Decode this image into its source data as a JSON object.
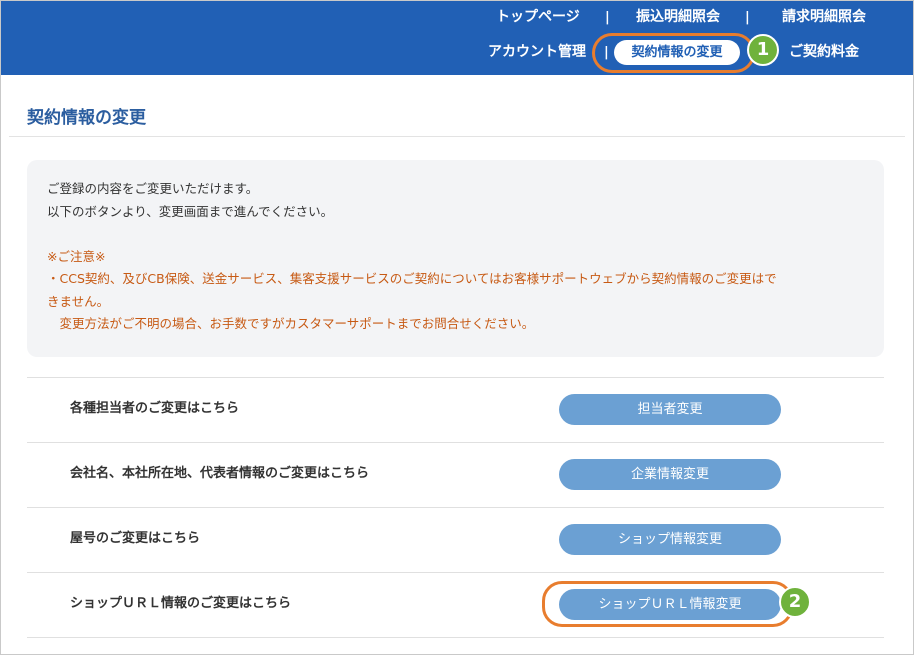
{
  "header": {
    "nav_top": [
      "トップページ",
      "振込明細照会",
      "請求明細照会"
    ],
    "nav_bottom": {
      "account": "アカウント管理",
      "active": "契約情報の変更",
      "fee": "ご契約料金"
    },
    "separator": "|",
    "bg_color": "#2160b5"
  },
  "page": {
    "title": "契約情報の変更"
  },
  "notice": {
    "line1": "ご登録の内容をご変更いただけます。",
    "line2": "以下のボタンより、変更画面まで進んでください。",
    "caution_title": "※ご注意※",
    "caution1": "・CCS契約、及びCB保険、送金サービス、集客支援サービスのご契約についてはお客様サポートウェブから契約情報のご変更はで",
    "caution2": "きません。",
    "caution3": "　変更方法がご不明の場合、お手数ですがカスタマーサポートまでお問合せください。"
  },
  "rows": [
    {
      "label": "各種担当者のご変更はこちら",
      "button": "担当者変更"
    },
    {
      "label": "会社名、本社所在地、代表者情報のご変更はこちら",
      "button": "企業情報変更"
    },
    {
      "label": "屋号のご変更はこちら",
      "button": "ショップ情報変更"
    },
    {
      "label": "ショップＵＲＬ情報のご変更はこちら",
      "button": "ショップＵＲＬ情報変更"
    }
  ],
  "annotations": {
    "step1": "1",
    "step2": "2",
    "highlight_color": "#e87d2e",
    "badge_color": "#6fb23c"
  }
}
